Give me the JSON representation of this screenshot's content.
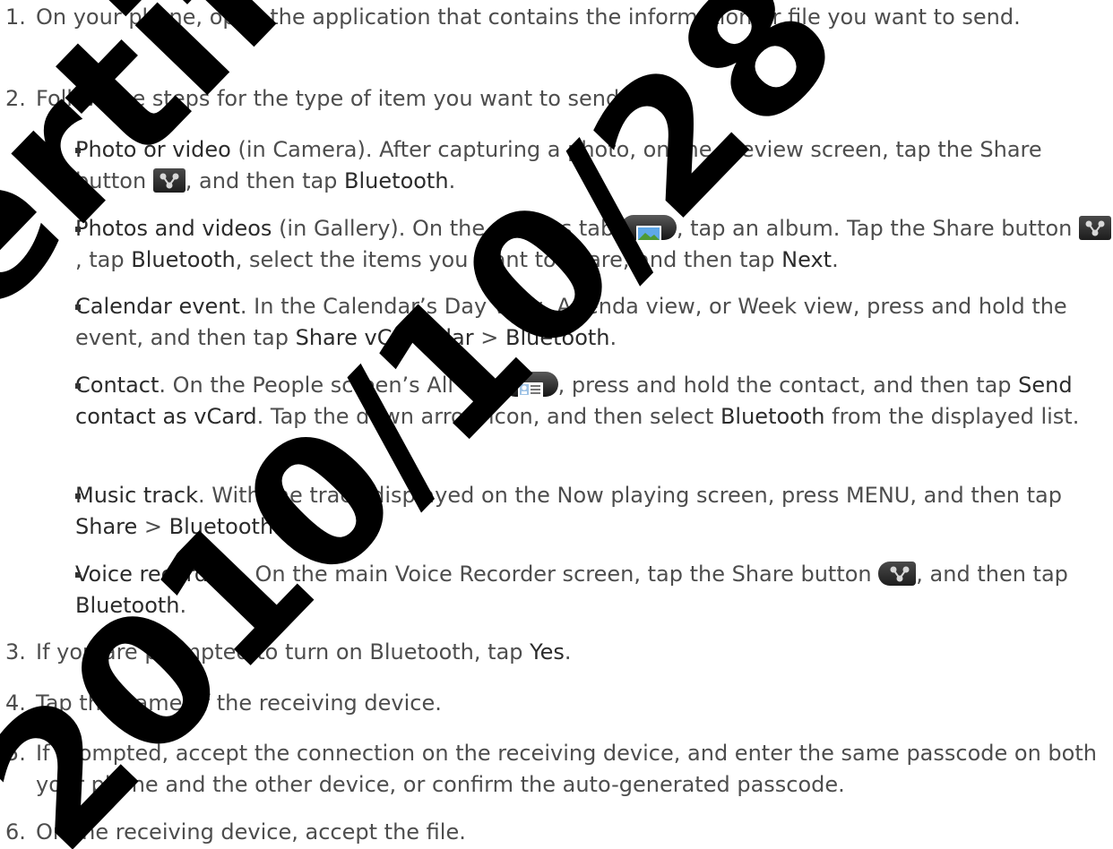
{
  "steps": [
    {
      "num": "1.",
      "text": "On your phone, open the application that contains the information or file you want to send."
    },
    {
      "num": "2.",
      "text": "Follow the steps for the type of item you want to send:"
    },
    {
      "num": "3.",
      "pre": "If you are prompted to turn on Bluetooth, tap ",
      "hl": "Yes",
      "post": "."
    },
    {
      "num": "4.",
      "text": "Tap the name of the receiving device."
    },
    {
      "num": "5.",
      "text": "If prompted, accept the connection on the receiving device, and enter the same passcode on both your phone and the other device, or confirm the auto-generated passcode."
    },
    {
      "num": "6.",
      "text": "On the receiving device, accept the file."
    }
  ],
  "bullets": {
    "camera": {
      "title": "Photo or video",
      "t1": " (in Camera). After capturing a photo, on the preview screen, tap the Share button ",
      "t2": ", and then tap ",
      "bt": "Bluetooth",
      "t3": "."
    },
    "gallery": {
      "title": "Photos and videos",
      "t1": " (in Gallery). On the Albums tab ",
      "t2": ", tap an album. Tap the Share button ",
      "t3": ", tap ",
      "bt": "Bluetooth",
      "t4": ", select the items you want to share, and then tap ",
      "next": "Next",
      "t5": "."
    },
    "calendar": {
      "title": "Calendar event",
      "t1": ". In the Calendar’s Day view, Agenda view, or Week view, press and hold the event, and then tap ",
      "share": "Share vCalendar",
      "t2": " > ",
      "bt": "Bluetooth",
      "t3": "."
    },
    "contact": {
      "title": "Contact",
      "t1": ". On the People screen’s All tab ",
      "t2": ", press and hold the contact, and then tap ",
      "send": "Send contact as vCard",
      "t3": ". Tap the down arrow icon, and then select ",
      "bt": "Bluetooth",
      "t4": " from the displayed list."
    },
    "music": {
      "title": "Music track",
      "t1": ". With the track displayed on the Now playing screen, press MENU, and then tap ",
      "share": "Share",
      "t2": " > ",
      "bt": "Bluetooth",
      "t3": "."
    },
    "voice": {
      "title": "Voice recording",
      "t1": ". On the main Voice Recorder screen, tap the Share button ",
      "t2": ", and then tap ",
      "bt": "Bluetooth",
      "t3": "."
    }
  },
  "icons": {
    "share": "share-icon",
    "albums": "albums-tab-icon",
    "people_all": "people-all-tab-icon"
  },
  "watermark": {
    "text_a": "Certificat",
    "text_b": "2010/10/28",
    "color": "#000000"
  }
}
